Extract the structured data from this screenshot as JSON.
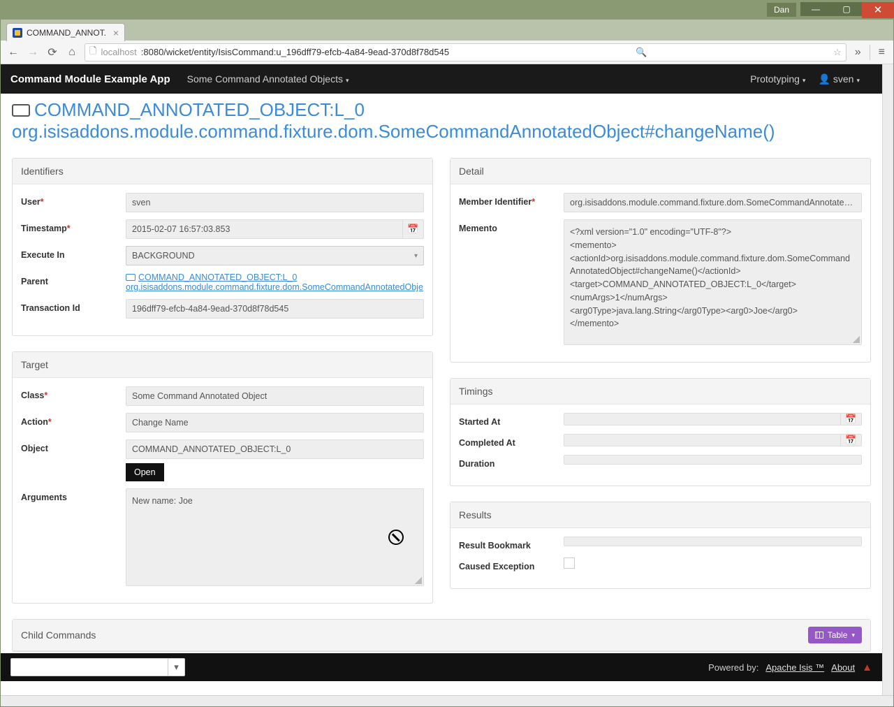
{
  "os": {
    "user": "Dan"
  },
  "browser": {
    "tab_title": "COMMAND_ANNOT.",
    "url_host": "localhost",
    "url_port_path": ":8080/wicket/entity/IsisCommand:u_196dff79-efcb-4a84-9ead-370d8f78d545"
  },
  "nav": {
    "brand": "Command Module Example App",
    "menu1": "Some Command Annotated Objects",
    "right1": "Prototyping",
    "user": "sven"
  },
  "heading": {
    "line1": "COMMAND_ANNOTATED_OBJECT:L_0",
    "line2": "org.isisaddons.module.command.fixture.dom.SomeCommandAnnotatedObject#changeName()"
  },
  "identifiers": {
    "title": "Identifiers",
    "user_label": "User",
    "user_value": "sven",
    "timestamp_label": "Timestamp",
    "timestamp_value": "2015-02-07 16:57:03.853",
    "executein_label": "Execute In",
    "executein_value": "BACKGROUND",
    "parent_label": "Parent",
    "parent_link1": "COMMAND_ANNOTATED_OBJECT:L_0",
    "parent_link2": "org.isisaddons.module.command.fixture.dom.SomeCommandAnnotatedObje",
    "txid_label": "Transaction Id",
    "txid_value": "196dff79-efcb-4a84-9ead-370d8f78d545"
  },
  "target": {
    "title": "Target",
    "class_label": "Class",
    "class_value": "Some Command Annotated Object",
    "action_label": "Action",
    "action_value": "Change Name",
    "object_label": "Object",
    "object_value": "COMMAND_ANNOTATED_OBJECT:L_0",
    "open_btn": "Open",
    "arguments_label": "Arguments",
    "arguments_value": "New name: Joe"
  },
  "detail": {
    "title": "Detail",
    "member_label": "Member Identifier",
    "member_value": "org.isisaddons.module.command.fixture.dom.SomeCommandAnnotatedObj",
    "memento_label": "Memento",
    "memento_value": "<?xml version=\"1.0\" encoding=\"UTF-8\"?>\n<memento>\n<actionId>org.isisaddons.module.command.fixture.dom.SomeCommandAnnotatedObject#changeName()</actionId>\n<target>COMMAND_ANNOTATED_OBJECT:L_0</target>\n<numArgs>1</numArgs>\n<arg0Type>java.lang.String</arg0Type><arg0>Joe</arg0>\n</memento>"
  },
  "timings": {
    "title": "Timings",
    "started_label": "Started At",
    "started_value": "",
    "completed_label": "Completed At",
    "completed_value": "",
    "duration_label": "Duration",
    "duration_value": ""
  },
  "results": {
    "title": "Results",
    "bookmark_label": "Result Bookmark",
    "bookmark_value": "",
    "exception_label": "Caused Exception"
  },
  "child": {
    "title": "Child Commands",
    "table_btn": "Table"
  },
  "footer": {
    "powered": "Powered by:",
    "isis": "Apache Isis ™",
    "about": "About"
  }
}
